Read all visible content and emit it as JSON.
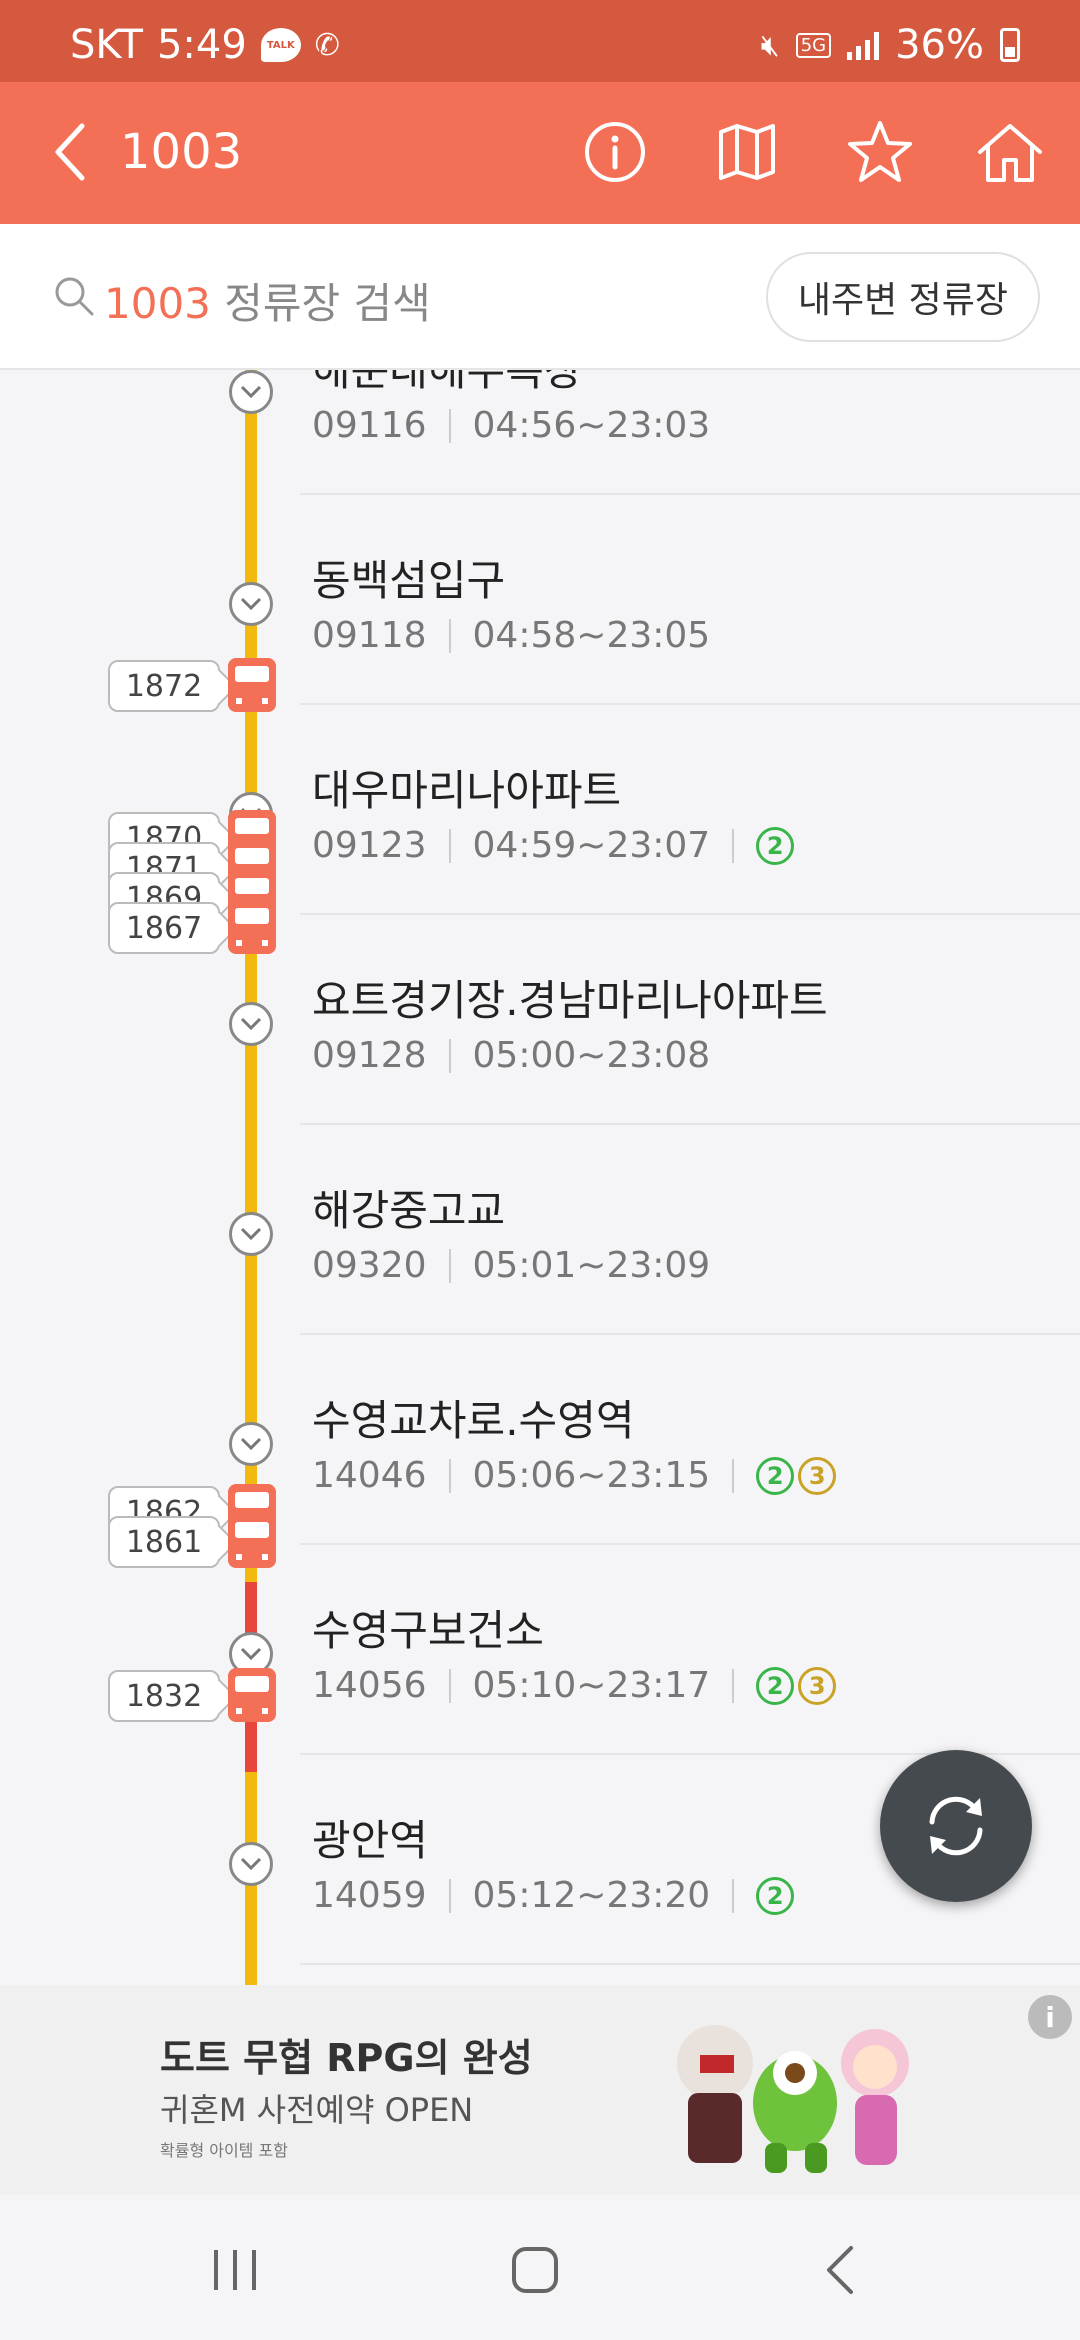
{
  "status_bar": {
    "carrier": "SKT",
    "time": "5:49",
    "talk_badge": "TALK",
    "network": "5G",
    "battery": "36%"
  },
  "header": {
    "route_number": "1003",
    "icons": [
      "back-icon",
      "info-icon",
      "map-icon",
      "star-icon",
      "home-icon"
    ]
  },
  "search": {
    "highlight": "1003",
    "placeholder_rest": " 정류장 검색",
    "nearby_button": "내주변 정류장"
  },
  "stops": [
    {
      "name": "해운대해수욕장",
      "id": "09116",
      "hours": "04:56~23:03",
      "lines": []
    },
    {
      "name": "동백섬입구",
      "id": "09118",
      "hours": "04:58~23:05",
      "lines": []
    },
    {
      "name": "대우마리나아파트",
      "id": "09123",
      "hours": "04:59~23:07",
      "lines": [
        "2"
      ]
    },
    {
      "name": "요트경기장.경남마리나아파트",
      "id": "09128",
      "hours": "05:00~23:08",
      "lines": []
    },
    {
      "name": "해강중고교",
      "id": "09320",
      "hours": "05:01~23:09",
      "lines": []
    },
    {
      "name": "수영교차로.수영역",
      "id": "14046",
      "hours": "05:06~23:15",
      "lines": [
        "2",
        "3"
      ]
    },
    {
      "name": "수영구보건소",
      "id": "14056",
      "hours": "05:10~23:17",
      "lines": [
        "2",
        "3"
      ]
    },
    {
      "name": "광안역",
      "id": "14059",
      "hours": "05:12~23:20",
      "lines": [
        "2"
      ]
    }
  ],
  "buses": [
    "1872",
    "1870",
    "1871",
    "1869",
    "1867",
    "1862",
    "1861",
    "1832"
  ],
  "colors": {
    "status_bar": "#d5593e",
    "header": "#f36f55",
    "line_yellow": "#f2b90f",
    "line_red": "#e8453c",
    "subway_2": "#3ab54a",
    "subway_3": "#c9a227"
  },
  "ad": {
    "title": "도트 무협 RPG의 완성",
    "subtitle": "귀혼M 사전예약 OPEN",
    "note": "확률형 아이템 포함",
    "info": "i"
  }
}
